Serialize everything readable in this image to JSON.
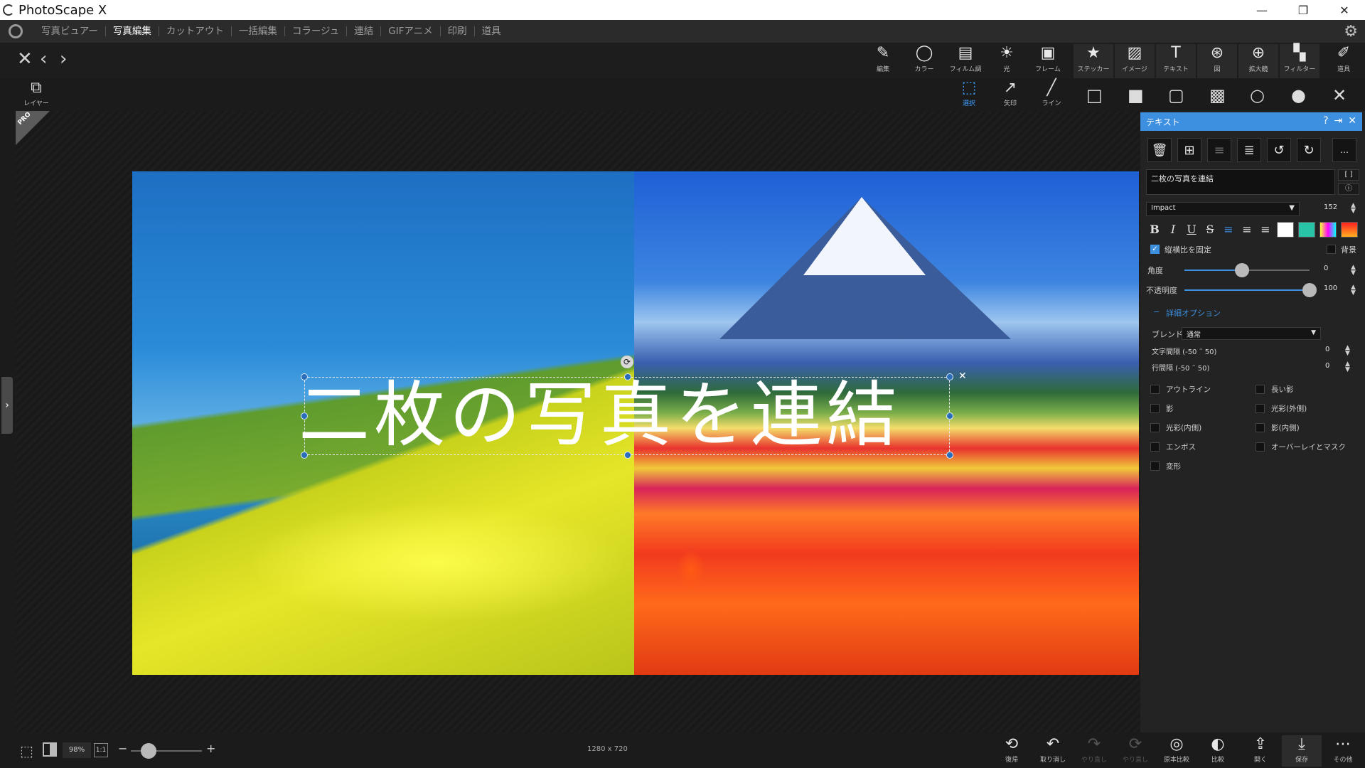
{
  "window": {
    "title": "PhotoScape X",
    "controls": [
      "—",
      "❐",
      "✕"
    ]
  },
  "menu": {
    "items": [
      "写真ビュアー",
      "写真編集",
      "カットアウト",
      "一括編集",
      "コラージュ",
      "連結",
      "GIFアニメ",
      "印刷",
      "道具"
    ],
    "active_index": 1
  },
  "nav": {
    "close": "✕",
    "prev": "‹",
    "next": "›"
  },
  "top_tools": [
    {
      "icon": "edit-icon",
      "glyph": "✎",
      "label": "編集"
    },
    {
      "icon": "color-icon",
      "glyph": "◯",
      "label": "カラー"
    },
    {
      "icon": "film-icon",
      "glyph": "▤",
      "label": "フィルム調"
    },
    {
      "icon": "light-icon",
      "glyph": "☀",
      "label": "光"
    },
    {
      "icon": "frame-icon",
      "glyph": "▣",
      "label": "フレーム"
    },
    {
      "icon": "sticker-icon",
      "glyph": "★",
      "label": "ステッカー"
    },
    {
      "icon": "image-icon",
      "glyph": "▨",
      "label": "イメージ"
    },
    {
      "icon": "text-icon",
      "glyph": "T",
      "label": "テキスト"
    },
    {
      "icon": "figure-icon",
      "glyph": "⊛",
      "label": "図"
    },
    {
      "icon": "magnifier-icon",
      "glyph": "⊕",
      "label": "拡大鏡"
    },
    {
      "icon": "filter-icon",
      "glyph": "▚",
      "label": "フィルター"
    },
    {
      "icon": "tools-icon",
      "glyph": "✐",
      "label": "道具"
    }
  ],
  "second_tools": {
    "layer": {
      "glyph": "⧉",
      "label": "レイヤー"
    },
    "select": {
      "glyph": "⬚",
      "label": "選択"
    },
    "arrow": {
      "glyph": "↗",
      "label": "矢印"
    },
    "line": {
      "glyph": "╱",
      "label": "ライン"
    },
    "shapes": [
      "□",
      "■",
      "▢",
      "▩",
      "○",
      "●"
    ],
    "close": "✕"
  },
  "canvas": {
    "pro_badge": "PRO",
    "overlay_text": "二枚の写真を連結",
    "rotate_glyph": "⟳",
    "delete_glyph": "✕",
    "sidetab_glyph": "›"
  },
  "panel": {
    "title": "テキスト",
    "head_icons": [
      "?",
      "⇥",
      "✕"
    ],
    "toolbar": [
      "🗑",
      "⊞",
      "≡",
      "≣",
      "↺",
      "↻",
      "…"
    ],
    "text_value": "二枚の写真を連結",
    "side_buttons": [
      "[ ]",
      "ⓘ"
    ],
    "font": "Impact",
    "font_size": "152",
    "format_buttons": [
      "B",
      "I",
      "U",
      "S"
    ],
    "align_glyphs": [
      "≡",
      "≡",
      "≡"
    ],
    "swatch_colors": [
      "#ffffff",
      "#29c3a8",
      "linear-gradient(90deg,#ff3,#f0f,#0ff)",
      "linear-gradient(180deg,#ff2020,#ffb020)"
    ],
    "keep_ratio_label": "縦横比を固定",
    "background_label": "背景",
    "angle_label": "角度",
    "angle_value": "0",
    "angle_fraction": 0.46,
    "opacity_label": "不透明度",
    "opacity_value": "100",
    "opacity_fraction": 1.0,
    "advanced_label": "詳細オプション",
    "blend_label": "ブレンド",
    "blend_value": "通常",
    "char_spacing_label": "文字間隔 (-50 ˜ 50)",
    "char_spacing_value": "0",
    "line_spacing_label": "行間隔 (-50 ˜ 50)",
    "line_spacing_value": "0",
    "effects_left": [
      "アウトライン",
      "影",
      "光彩(内側)",
      "エンボス",
      "変形"
    ],
    "effects_right": [
      "長い影",
      "光彩(外側)",
      "影(内側)",
      "オーバーレイとマスク"
    ]
  },
  "status": {
    "zoom": "98%",
    "one_to_one": "1:1",
    "minus": "−",
    "plus": "+",
    "zoom_fraction": 0.25,
    "dimensions": "1280 x 720"
  },
  "bottom_tools": [
    {
      "icon": "revert-icon",
      "glyph": "⟲",
      "label": "復帰",
      "enabled": true
    },
    {
      "icon": "undo-icon",
      "glyph": "↶",
      "label": "取り消し",
      "enabled": true
    },
    {
      "icon": "redo-icon",
      "glyph": "↷",
      "label": "やり直し",
      "enabled": false
    },
    {
      "icon": "redo-all-icon",
      "glyph": "⟳",
      "label": "やり直し",
      "enabled": false
    },
    {
      "icon": "original-compare-icon",
      "glyph": "◎",
      "label": "原本比較",
      "enabled": true
    },
    {
      "icon": "compare-icon",
      "glyph": "◐",
      "label": "比較",
      "enabled": true
    },
    {
      "icon": "open-icon",
      "glyph": "⇪",
      "label": "開く",
      "enabled": true
    },
    {
      "icon": "save-icon",
      "glyph": "⤓",
      "label": "保存",
      "enabled": true
    },
    {
      "icon": "more-icon",
      "glyph": "⋯",
      "label": "その他",
      "enabled": true
    }
  ]
}
